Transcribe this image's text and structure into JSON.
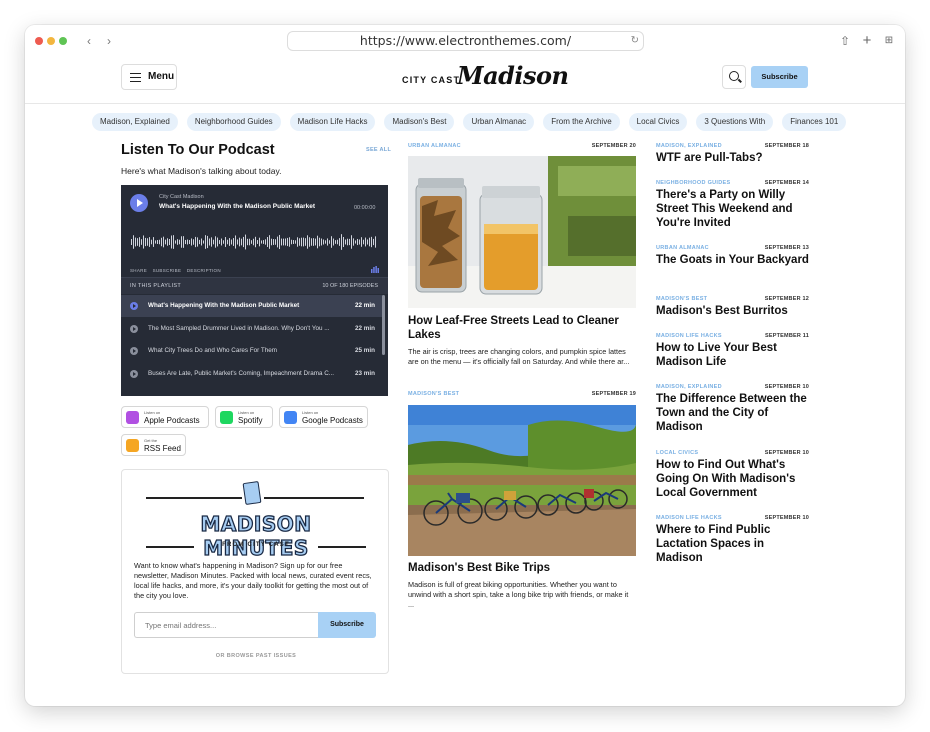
{
  "browser": {
    "url": "https://www.electronthemes.com/"
  },
  "header": {
    "menu_label": "Menu",
    "logo_small": "CITY CAST",
    "logo_big": "Madison",
    "subscribe_label": "Subscribe"
  },
  "categories": [
    "Madison, Explained",
    "Neighborhood Guides",
    "Madison Life Hacks",
    "Madison's Best",
    "Urban Almanac",
    "From the Archive",
    "Local Civics",
    "3 Questions With",
    "Finances 101"
  ],
  "podcast": {
    "title": "Listen To Our Podcast",
    "see_all": "SEE ALL",
    "subtitle": "Here's what Madison's talking about today.",
    "player": {
      "show": "City Cast Madison",
      "episode": "What's Happening With the Madison Public Market",
      "time": "00:00:00",
      "links": [
        "SHARE",
        "SUBSCRIBE",
        "DESCRIPTION"
      ],
      "playlist_label": "IN THIS PLAYLIST",
      "playlist_count": "10 OF 180 EPISODES",
      "episodes": [
        {
          "title": "What's Happening With the Madison Public Market",
          "duration": "22 min"
        },
        {
          "title": "The Most Sampled Drummer Lived in Madison. Why Don't You ...",
          "duration": "22 min"
        },
        {
          "title": "What City Trees Do and Who Cares For Them",
          "duration": "25 min"
        },
        {
          "title": "Buses Are Late, Public Market's Coming, Impeachment Drama C...",
          "duration": "23 min"
        }
      ]
    },
    "badges": [
      {
        "small": "Listen on",
        "large": "Apple Podcasts",
        "color": "#b150e2"
      },
      {
        "small": "Listen on",
        "large": "Spotify",
        "color": "#1ed760"
      },
      {
        "small": "Listen on",
        "large": "Google Podcasts",
        "color": "#4285f4"
      },
      {
        "small": "Get the",
        "large": "RSS Feed",
        "color": "#f5a623"
      }
    ]
  },
  "newsletter": {
    "logo_text": "MADISON MINUTES",
    "from_text": "FROM CITY CAST",
    "description": "Want to know what's happening in Madison? Sign up for our free newsletter, Madison Minutes. Packed with local news, curated event recs, local life hacks, and more, it's your daily toolkit for getting the most out of the city you love.",
    "email_placeholder": "Type email address...",
    "subscribe_label": "Subscribe",
    "browse_label": "OR BROWSE PAST ISSUES"
  },
  "featured": [
    {
      "category": "URBAN ALMANAC",
      "date": "SEPTEMBER 20",
      "title": "How Leaf-Free Streets Lead to Cleaner Lakes",
      "excerpt": "The air is crisp, trees are changing colors, and pumpkin spice lattes are on the menu — it's officially fall on Saturday. And while there ar..."
    },
    {
      "category": "MADISON'S BEST",
      "date": "SEPTEMBER 19",
      "title": "Madison's Best Bike Trips",
      "excerpt": "Madison is full of great biking opportunities. Whether you want to unwind with a short spin, take a long bike trip with friends, or make it ..."
    }
  ],
  "articles": [
    {
      "category": "MADISON, EXPLAINED",
      "date": "SEPTEMBER 18",
      "title": "WTF are Pull-Tabs?"
    },
    {
      "category": "NEIGHBORHOOD GUIDES",
      "date": "SEPTEMBER 14",
      "title": "There's a Party on Willy Street This Weekend and You're Invited"
    },
    {
      "category": "URBAN ALMANAC",
      "date": "SEPTEMBER 13",
      "title": "The Goats in Your Backyard"
    },
    {
      "category": "MADISON'S BEST",
      "date": "SEPTEMBER 12",
      "title": "Madison's Best Burritos"
    },
    {
      "category": "MADISON LIFE HACKS",
      "date": "SEPTEMBER 11",
      "title": "How to Live Your Best Madison Life"
    },
    {
      "category": "MADISON, EXPLAINED",
      "date": "SEPTEMBER 10",
      "title": "The Difference Between the Town and the City of Madison"
    },
    {
      "category": "LOCAL CIVICS",
      "date": "SEPTEMBER 10",
      "title": "How to Find Out What's Going On With Madison's Local Government"
    },
    {
      "category": "MADISON LIFE HACKS",
      "date": "SEPTEMBER 10",
      "title": "Where to Find Public Lactation Spaces in Madison"
    }
  ]
}
